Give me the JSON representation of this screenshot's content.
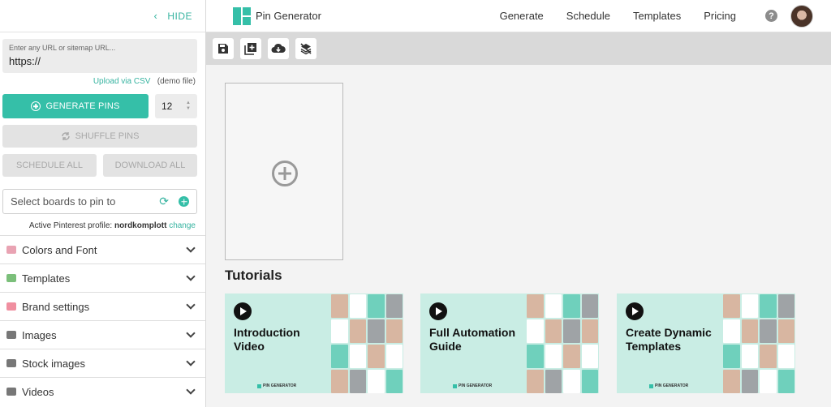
{
  "sidebar": {
    "hide_label": "HIDE",
    "url_input": {
      "placeholder": "Enter any URL or sitemap URL...",
      "value": "https://"
    },
    "upload_link": "Upload via CSV",
    "demo_file": "(demo file)",
    "generate_label": "GENERATE PINS",
    "pin_count": "12",
    "shuffle_label": "SHUFFLE PINS",
    "schedule_all_label": "SCHEDULE ALL",
    "download_all_label": "DOWNLOAD ALL",
    "boards_placeholder": "Select boards to pin to",
    "profile_prefix": "Active Pinterest profile:",
    "profile_name": "nordkomplott",
    "profile_change": "change",
    "sections": [
      {
        "label": "Colors and Font",
        "icon": "palette-icon",
        "color": "#e9a3b3"
      },
      {
        "label": "Templates",
        "icon": "image-icon",
        "color": "#7bbf7a"
      },
      {
        "label": "Brand settings",
        "icon": "brain-icon",
        "color": "#f08fa0"
      },
      {
        "label": "Images",
        "icon": "camera-icon",
        "color": "#777777"
      },
      {
        "label": "Stock images",
        "icon": "camera-icon",
        "color": "#777777"
      },
      {
        "label": "Videos",
        "icon": "projector-icon",
        "color": "#777777"
      }
    ]
  },
  "nav": {
    "brand": "Pin Generator",
    "links": [
      "Generate",
      "Schedule",
      "Templates",
      "Pricing"
    ],
    "help": "?"
  },
  "main": {
    "tutorials_heading": "Tutorials",
    "tutorials": [
      {
        "title": "Introduction Video"
      },
      {
        "title": "Full Automation Guide"
      },
      {
        "title": "Create Dynamic Templates"
      }
    ],
    "card_brand": "PIN GENERATOR"
  },
  "colors": {
    "accent": "#35bfa8",
    "toolbar": "#d9d9d9",
    "main_bg": "#f3f3f3",
    "card_bg": "#c9ede4"
  }
}
